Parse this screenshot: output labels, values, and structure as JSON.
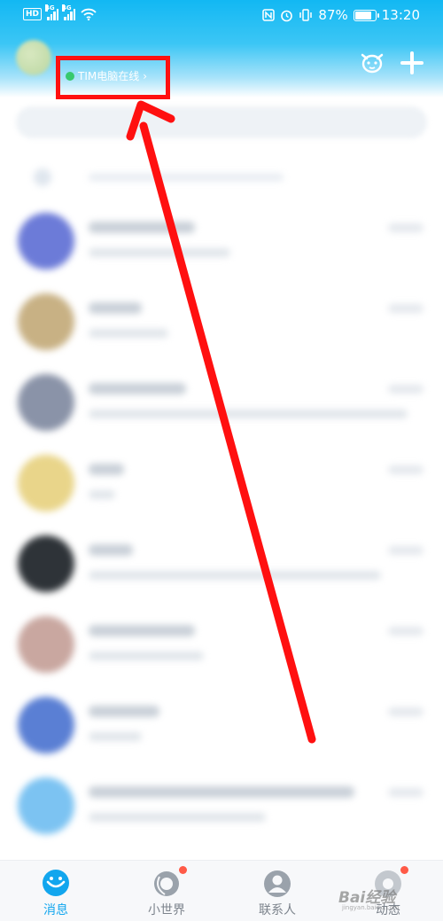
{
  "status_bar": {
    "hd_badge": "HD",
    "sim1_network": "4G",
    "sim2_network": "4G",
    "battery_percent": "87%",
    "battery_level": 0.87,
    "time": "13:20",
    "icons": [
      "wifi-icon",
      "nfc-icon",
      "alarm-icon",
      "vibrate-icon",
      "battery-icon"
    ]
  },
  "header": {
    "online_status": "TIM电脑在线",
    "online_chevron": "›",
    "online_dot_color": "#37c96e",
    "icons": [
      "pet-icon",
      "plus-icon"
    ]
  },
  "annotation": {
    "box_color": "#ff1010",
    "arrow_color": "#ff1010"
  },
  "conversations": [
    {
      "avatar_color": "#6c7bd8"
    },
    {
      "avatar_color": "#c8b184"
    },
    {
      "avatar_color": "#8a93a8"
    },
    {
      "avatar_color": "#e9d58a"
    },
    {
      "avatar_color": "#2e3338"
    },
    {
      "avatar_color": "#c9a7a0"
    },
    {
      "avatar_color": "#5a7fd4"
    },
    {
      "avatar_color": "#7cc3f2"
    }
  ],
  "tabbar": {
    "tabs": [
      {
        "label": "消息",
        "icon": "qq-message-icon",
        "active": true
      },
      {
        "label": "小世界",
        "icon": "small-world-icon",
        "badge": true
      },
      {
        "label": "联系人",
        "icon": "contacts-icon"
      },
      {
        "label": "动态",
        "icon": "moments-icon",
        "badge": true
      }
    ],
    "accent_color": "#12a6ee"
  },
  "watermark": {
    "text": "Bai经验",
    "sub": "jingyan.baidu.com"
  }
}
